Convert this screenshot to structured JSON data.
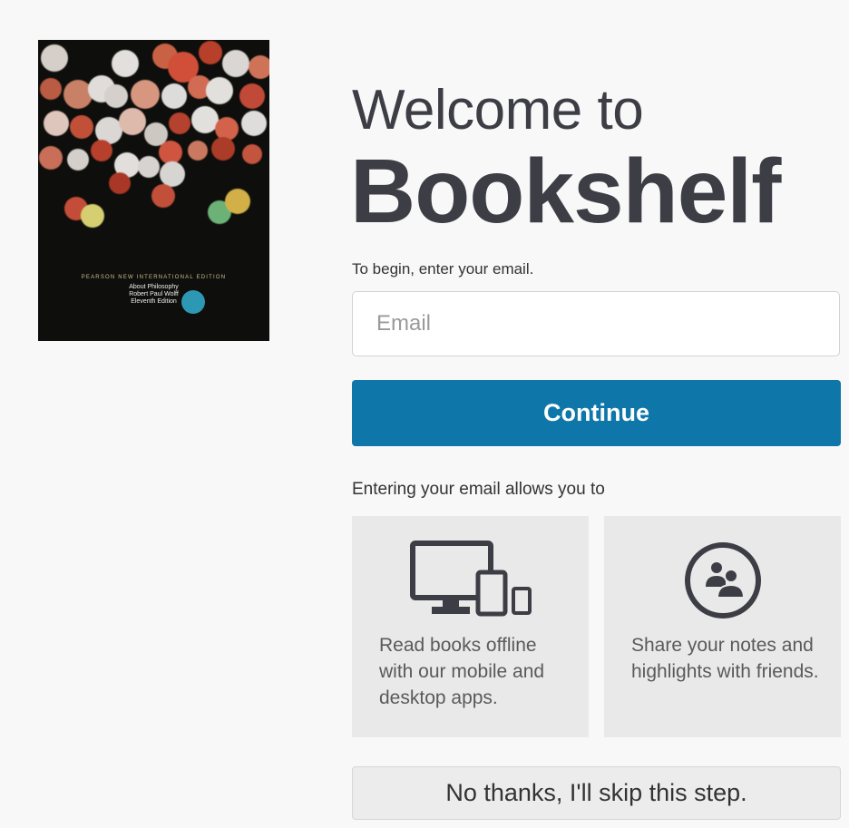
{
  "book": {
    "edition_banner": "PEARSON NEW INTERNATIONAL EDITION",
    "title": "About Philosophy",
    "author": "Robert Paul Wolff",
    "edition": "Eleventh Edition"
  },
  "welcome": {
    "line1": "Welcome to",
    "brand": "Bookshelf"
  },
  "form": {
    "prompt": "To begin, enter your email.",
    "email_placeholder": "Email",
    "email_value": "",
    "continue_label": "Continue"
  },
  "benefits": {
    "intro": "Entering your email allows you to",
    "items": [
      {
        "icon": "devices-icon",
        "text": "Read books offline with our mobile and desktop apps."
      },
      {
        "icon": "share-people-icon",
        "text": "Share your notes and highlights with friends."
      }
    ]
  },
  "skip_label": "No thanks, I'll skip this step.",
  "colors": {
    "primary": "#0e76a8",
    "heading": "#3d3d45",
    "card_bg": "#e9e9ea",
    "page_bg": "#f8f8f8"
  }
}
